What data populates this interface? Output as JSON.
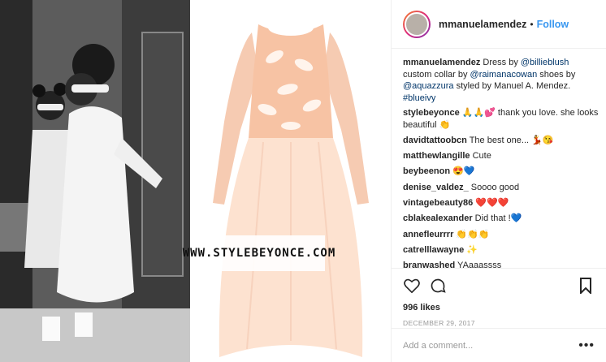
{
  "colors": {
    "accent": "#3897f0",
    "tag": "#003569",
    "muted": "#999999",
    "text": "#262626"
  },
  "watermark": "WWW.STYLEBEYONCE.COM",
  "header": {
    "username": "mmanuelamendez",
    "dot": "•",
    "follow_label": "Follow"
  },
  "caption": {
    "username": "mmanuelamendez",
    "t1": " Dress by ",
    "tag1": "@billieblush",
    "t2": " custom collar by ",
    "tag2": "@raimanacowan",
    "t3": " shoes by ",
    "tag3": "@aquazzura",
    "t4": " styled by Manuel A. Mendez. ",
    "tag4": "#blueivy"
  },
  "comments": [
    {
      "username": "stylebeyonce",
      "text": " 🙏🙏💕 thank you love. she looks beautiful 👏"
    },
    {
      "username": "davidtattoobcn",
      "text": " The best one... 💃😘"
    },
    {
      "username": "matthewlangille",
      "text": " Cute"
    },
    {
      "username": "beybeenon",
      "text": " 😍💙"
    },
    {
      "username": "denise_valdez_",
      "text": " Soooo good"
    },
    {
      "username": "vintagebeauty86",
      "text": " ❤️❤️❤️"
    },
    {
      "username": "cblakealexander",
      "text": " Did that !💙"
    },
    {
      "username": "annefleurrrr",
      "text": " 👏👏👏"
    },
    {
      "username": "catrelllawayne",
      "text": " ✨"
    },
    {
      "username": "branwashed",
      "text": " YAaaassss"
    }
  ],
  "icons": {
    "like": "heart-icon",
    "comment": "comment-icon",
    "save": "bookmark-icon",
    "more": "more-icon"
  },
  "likes_label": "996 likes",
  "date_label": "DECEMBER 29, 2017",
  "add_comment": {
    "placeholder": "Add a comment...",
    "more_label": "•••"
  }
}
